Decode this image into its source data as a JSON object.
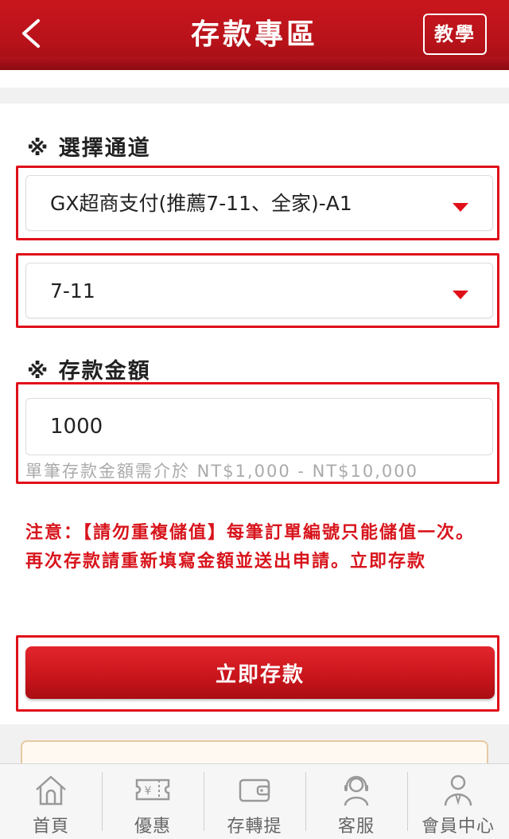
{
  "header": {
    "title": "存款專區",
    "tutorial_label": "教學",
    "back_icon": "chevron-left-icon"
  },
  "channel": {
    "label": "※ 選擇通道",
    "selected_channel": "GX超商支付(推薦7-11、全家)-A1",
    "selected_store": "7-11"
  },
  "amount": {
    "label": "※ 存款金額",
    "value": "1000",
    "hint": "單筆存款金額需介於 NT$1,000 - NT$10,000"
  },
  "notice": "注意：【請勿重複儲值】每筆訂單編號只能儲值一次。再次存款請重新填寫金額並送出申請。立即存款",
  "submit_label": "立即存款",
  "nav": [
    {
      "label": "首頁",
      "icon": "home-icon"
    },
    {
      "label": "優惠",
      "icon": "coupon-icon"
    },
    {
      "label": "存轉提",
      "icon": "wallet-icon"
    },
    {
      "label": "客服",
      "icon": "headset-icon"
    },
    {
      "label": "會員中心",
      "icon": "user-icon"
    }
  ],
  "colors": {
    "brand_red": "#c9161d",
    "highlight_red": "#e0101a",
    "notice_red": "#d8141c"
  }
}
